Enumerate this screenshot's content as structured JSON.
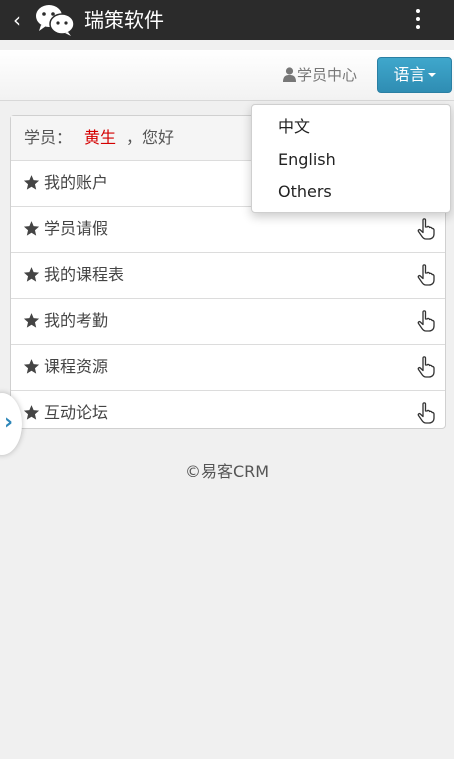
{
  "titlebar": {
    "back": "‹",
    "title": "瑞策软件"
  },
  "nav": {
    "user_center": "学员中心",
    "language_button": "语言"
  },
  "panel": {
    "student_label": "学员：",
    "student_name": "黄生",
    "greeting": "，您好",
    "items": [
      {
        "label": "我的账户"
      },
      {
        "label": "学员请假"
      },
      {
        "label": "我的课程表"
      },
      {
        "label": "我的考勤"
      },
      {
        "label": "课程资源"
      },
      {
        "label": "互动论坛"
      }
    ]
  },
  "language_menu": {
    "options": [
      "中文",
      "English",
      "Others"
    ]
  },
  "footer": "©易客CRM",
  "colors": {
    "titlebar": "#2b2b2b",
    "accent": "#3399c2",
    "student_name": "#d40000",
    "side_arrow": "#2d86b8"
  },
  "icons": {
    "app_logo": "wechat-logo-icon",
    "more": "more-vertical-icon",
    "user": "user-icon",
    "item": "star-icon",
    "item_action": "hand-pointer-icon",
    "side": "chevron-right-icon"
  }
}
